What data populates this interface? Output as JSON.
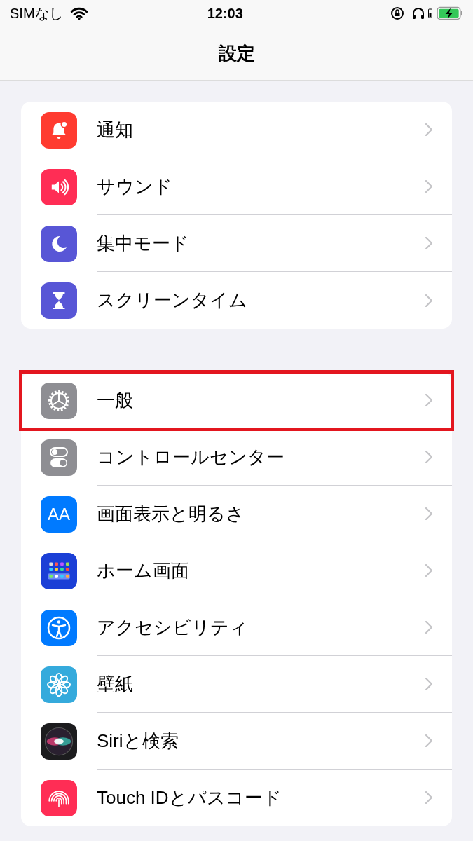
{
  "status_bar": {
    "carrier": "SIMなし",
    "time": "12:03"
  },
  "nav": {
    "title": "設定"
  },
  "groups": [
    {
      "items": [
        {
          "label": "通知",
          "kind": "bell",
          "color": "#ff3b30",
          "highlighted": false
        },
        {
          "label": "サウンド",
          "kind": "speaker",
          "color": "#ff2d55",
          "highlighted": false
        },
        {
          "label": "集中モード",
          "kind": "moon",
          "color": "#5856d6",
          "highlighted": false
        },
        {
          "label": "スクリーンタイム",
          "kind": "hourglass",
          "color": "#5856d6",
          "highlighted": false
        }
      ]
    },
    {
      "items": [
        {
          "label": "一般",
          "kind": "gear",
          "color": "#8e8e93",
          "highlighted": true
        },
        {
          "label": "コントロールセンター",
          "kind": "toggles",
          "color": "#8e8e93",
          "highlighted": false
        },
        {
          "label": "画面表示と明るさ",
          "kind": "text",
          "icon_text": "AA",
          "color": "#007aff",
          "highlighted": false
        },
        {
          "label": "ホーム画面",
          "kind": "grid",
          "color": "#1b3fd6",
          "highlighted": false
        },
        {
          "label": "アクセシビリティ",
          "kind": "accessibility",
          "color": "#007aff",
          "highlighted": false
        },
        {
          "label": "壁紙",
          "kind": "flower",
          "color": "#35aadc",
          "highlighted": false
        },
        {
          "label": "Siriと検索",
          "kind": "siri",
          "color": "#1c1c1e",
          "highlighted": false
        },
        {
          "label": "Touch IDとパスコード",
          "kind": "fingerprint",
          "color": "#ff2d55",
          "highlighted": false
        }
      ]
    }
  ]
}
